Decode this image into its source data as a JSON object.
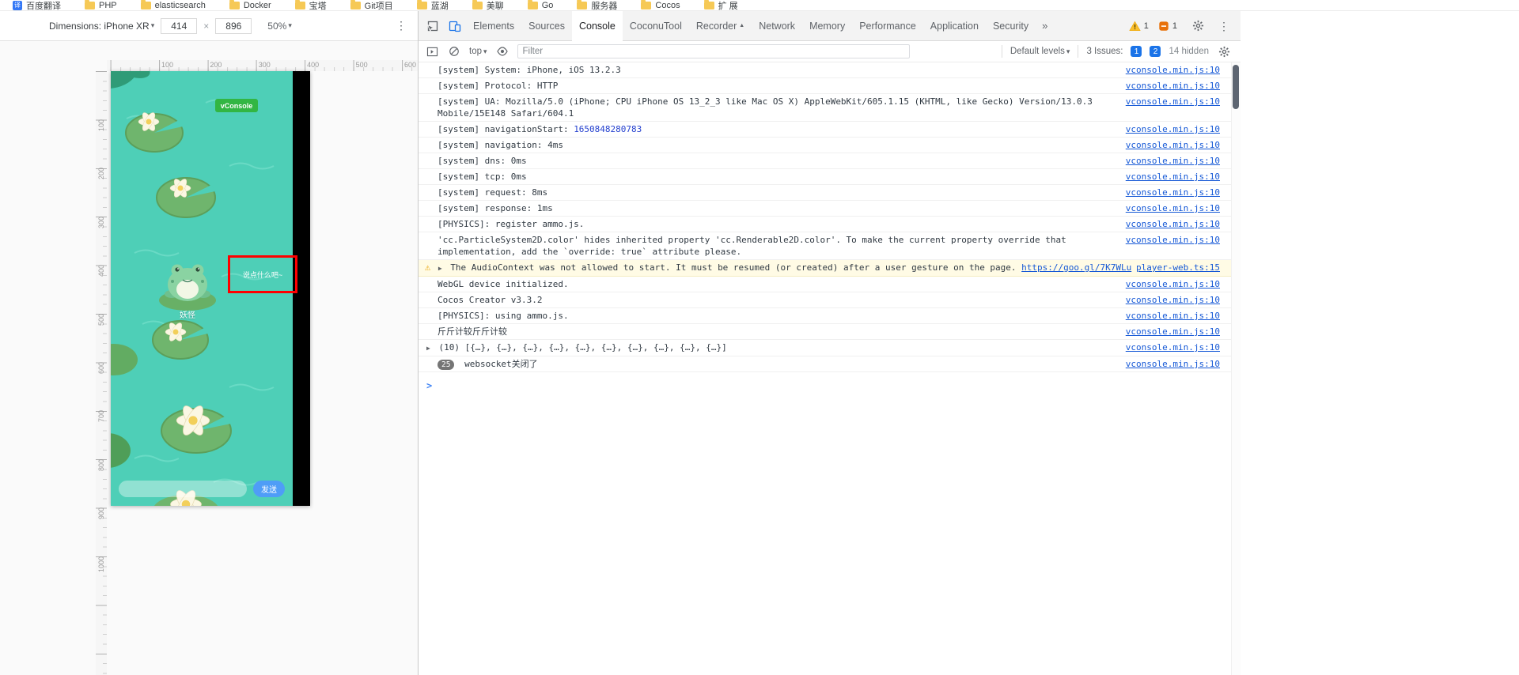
{
  "icons": {
    "caret": "▾",
    "kebab": "⋮",
    "warning": "⚠",
    "baidu_glyph": "译"
  },
  "bookmarks_bar": {
    "items": [
      {
        "label": "百度翻译",
        "icon": "baidu-translate"
      },
      {
        "label": "PHP",
        "icon": "folder"
      },
      {
        "label": "elasticsearch",
        "icon": "folder"
      },
      {
        "label": "Docker",
        "icon": "folder"
      },
      {
        "label": "宝塔",
        "icon": "folder"
      },
      {
        "label": "Git项目",
        "icon": "folder"
      },
      {
        "label": "蓝湖",
        "icon": "folder"
      },
      {
        "label": "美聊",
        "icon": "folder"
      },
      {
        "label": "Go",
        "icon": "folder"
      },
      {
        "label": "服务器",
        "icon": "folder"
      },
      {
        "label": "Cocos",
        "icon": "folder"
      },
      {
        "label": "扩 展",
        "icon": "folder"
      }
    ]
  },
  "device_toolbar": {
    "dimensions_label": "Dimensions: iPhone XR",
    "width_value": "414",
    "times": "×",
    "height_value": "896",
    "zoom_value": "50%"
  },
  "rulers": {
    "horizontal": [
      "100",
      "200",
      "300",
      "400",
      "500",
      "600"
    ],
    "vertical": [
      "100",
      "200",
      "300",
      "400",
      "500",
      "600",
      "700",
      "800",
      "900",
      "1000"
    ]
  },
  "game": {
    "vconsole_button": "vConsole",
    "character_name": "妖怪",
    "chat_bubble": "说点什么吧~",
    "send_button": "发送"
  },
  "devtools": {
    "tabs": [
      {
        "label": "Elements"
      },
      {
        "label": "Sources"
      },
      {
        "label": "Console",
        "active": true
      },
      {
        "label": "CoconuTool"
      },
      {
        "label": "Recorder",
        "marker": "▲"
      },
      {
        "label": "Network"
      },
      {
        "label": "Memory"
      },
      {
        "label": "Performance"
      },
      {
        "label": "Application"
      },
      {
        "label": "Security"
      }
    ],
    "tabs_overflow": "»",
    "warning_count": "1",
    "issues_count": "1",
    "console_toolbar": {
      "context": "top",
      "filter_placeholder": "Filter",
      "levels": "Default levels",
      "issues_label": "3 Issues:",
      "issue_badge_1": "1",
      "issue_badge_2": "2",
      "hidden_label": "14 hidden"
    },
    "console": {
      "messages": [
        {
          "text": "[system] System: iPhone, iOS 13.2.3",
          "source": "vconsole.min.js:10"
        },
        {
          "text": "[system] Protocol: HTTP",
          "source": "vconsole.min.js:10"
        },
        {
          "text": "[system] UA: Mozilla/5.0 (iPhone; CPU iPhone OS 13_2_3 like Mac OS X) AppleWebKit/605.1.15 (KHTML, like Gecko) Version/13.0.3 Mobile/15E148 Safari/604.1",
          "source": "vconsole.min.js:10"
        },
        {
          "text": "[system] navigationStart: ",
          "number": "1650848280783",
          "source": "vconsole.min.js:10"
        },
        {
          "text": "[system] navigation: 4ms",
          "source": "vconsole.min.js:10"
        },
        {
          "text": "[system] dns: 0ms",
          "source": "vconsole.min.js:10"
        },
        {
          "text": "[system] tcp: 0ms",
          "source": "vconsole.min.js:10"
        },
        {
          "text": "[system] request: 8ms",
          "source": "vconsole.min.js:10"
        },
        {
          "text": "[system] response: 1ms",
          "source": "vconsole.min.js:10"
        },
        {
          "text": "[PHYSICS]: register ammo.js.",
          "source": "vconsole.min.js:10"
        },
        {
          "text": "'cc.ParticleSystem2D.color' hides inherited property 'cc.Renderable2D.color'. To make the current property override that implementation, add the `override: true` attribute please.",
          "source": "vconsole.min.js:10"
        },
        {
          "type": "warning",
          "arrow": "▶",
          "text": "The AudioContext was not allowed to start. It must be resumed (or created) after a user gesture on the page. ",
          "link": "https://goo.gl/7K7WLu",
          "source": "player-web.ts:15"
        },
        {
          "text": "WebGL device initialized.",
          "source": "vconsole.min.js:10"
        },
        {
          "text": "Cocos Creator v3.3.2",
          "source": "vconsole.min.js:10"
        },
        {
          "text": "[PHYSICS]: using ammo.js.",
          "source": "vconsole.min.js:10"
        },
        {
          "text": "斤斤计较斤斤计较",
          "source": "vconsole.min.js:10"
        },
        {
          "type": "log-expand",
          "arrow": "▶",
          "text": "(10) [{…}, {…}, {…}, {…}, {…}, {…}, {…}, {…}, {…}, {…}]",
          "source": "vconsole.min.js:10"
        },
        {
          "badge": "25",
          "text": "websocket关闭了",
          "source": "vconsole.min.js:10"
        }
      ],
      "prompt": ">"
    }
  },
  "colors": {
    "game_teal": "#4ecfb7",
    "vconsole_green": "#32b643",
    "send_blue": "#4f9df7",
    "annotation_red": "#ff0000",
    "accent_blue": "#1a73e8",
    "link_blue": "#1558d6",
    "number_blue": "#2440cf",
    "warning_bg": "#fffbe5"
  }
}
